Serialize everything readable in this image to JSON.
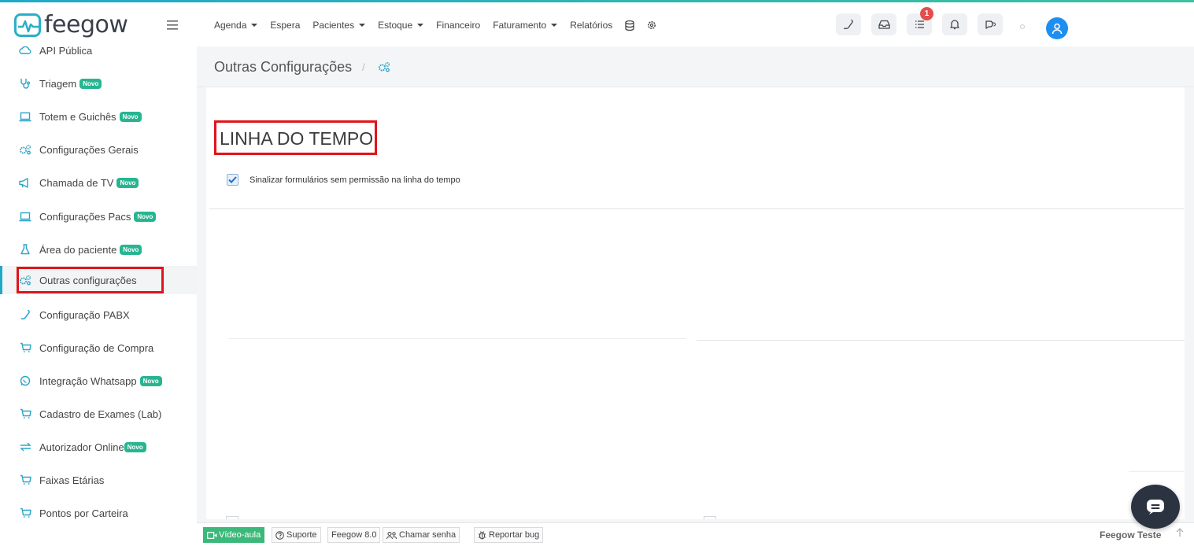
{
  "app": {
    "name": "feegow",
    "brand_color": "#2ab0c6",
    "accent_color": "#1ea9c9"
  },
  "header": {
    "menu_icon": "hamburger-icon",
    "nav": [
      {
        "label": "Agenda",
        "has_dropdown": true
      },
      {
        "label": "Espera",
        "has_dropdown": false
      },
      {
        "label": "Pacientes",
        "has_dropdown": true
      },
      {
        "label": "Estoque",
        "has_dropdown": true
      },
      {
        "label": "Financeiro",
        "has_dropdown": false
      },
      {
        "label": "Faturamento",
        "has_dropdown": true
      },
      {
        "label": "Relatórios",
        "has_dropdown": false
      }
    ],
    "nav_icons": [
      "database-icon",
      "gear-icon"
    ],
    "buttons": [
      "phone-icon",
      "inbox-icon",
      "tasks-icon",
      "bell-icon",
      "chat-icon"
    ],
    "tasks_badge": "1"
  },
  "sidebar": {
    "items": [
      {
        "label": "API Pública",
        "icon": "cloud-icon",
        "novo": false
      },
      {
        "label": "Triagem",
        "icon": "stethoscope-icon",
        "novo": true
      },
      {
        "label": "Totem e Guichês",
        "icon": "laptop-icon",
        "novo": true
      },
      {
        "label": "Configurações Gerais",
        "icon": "gears-icon",
        "novo": false
      },
      {
        "label": "Chamada de TV",
        "icon": "megaphone-icon",
        "novo": true
      },
      {
        "label": "Configurações Pacs",
        "icon": "laptop-icon",
        "novo": true
      },
      {
        "label": "Área do paciente",
        "icon": "flask-icon",
        "novo": true
      },
      {
        "label": "Outras configurações",
        "icon": "gears-icon",
        "novo": false,
        "active": true
      },
      {
        "label": "Configuração PABX",
        "icon": "phone-icon",
        "novo": false
      },
      {
        "label": "Configuração de Compra",
        "icon": "cart-icon",
        "novo": false
      },
      {
        "label": "Integração Whatsapp",
        "icon": "whatsapp-icon",
        "novo": true
      },
      {
        "label": "Cadastro de Exames (Lab)",
        "icon": "cart-icon",
        "novo": false
      },
      {
        "label": "Autorizador Online",
        "icon": "exchange-icon",
        "novo": true
      },
      {
        "label": "Faixas Etárias",
        "icon": "cart-icon",
        "novo": false
      },
      {
        "label": "Pontos por Carteira",
        "icon": "cart-icon",
        "novo": false
      }
    ],
    "novo_label": "Novo"
  },
  "breadcrumb": {
    "title": "Outras Configurações",
    "separator": "/"
  },
  "section": {
    "title": "LINHA DO TEMPO",
    "checkbox_label": "Sinalizar formulários sem permissão na linha do tempo",
    "checkbox_checked": true
  },
  "footer": {
    "video": "Vídeo-aula",
    "support": "Suporte",
    "version": "Feegow 8.0",
    "call": "Chamar senha",
    "bug": "Reportar bug",
    "user": "Feegow Teste"
  }
}
